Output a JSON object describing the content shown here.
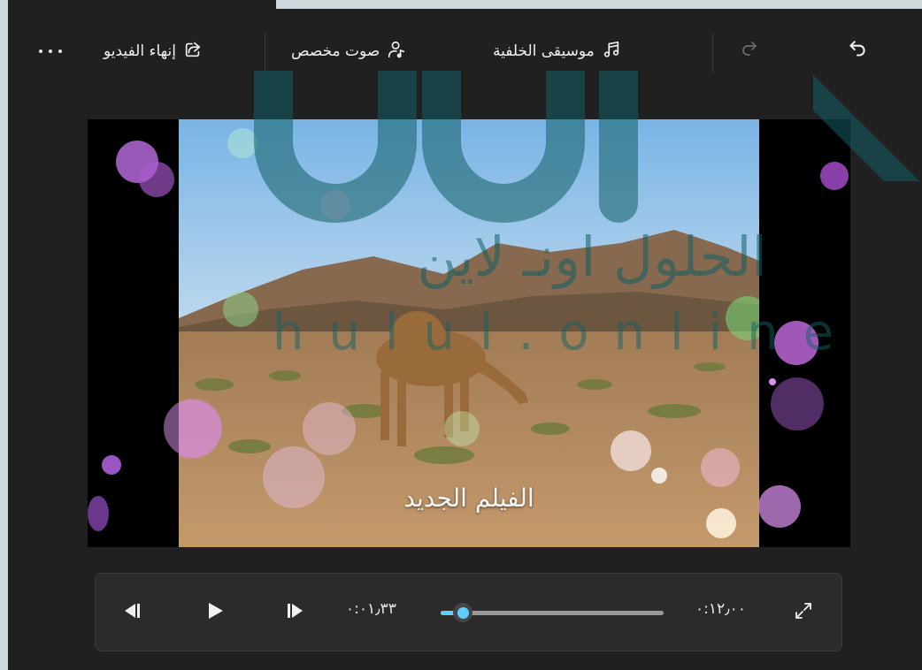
{
  "toolbar": {
    "undo_icon": "undo-icon",
    "redo_icon": "redo-icon",
    "background_music_label": "موسيقى الخلفية",
    "custom_audio_label": "صوت مخصص",
    "finish_video_label": "إنهاء الفيديو",
    "more_icon": "more-dots-icon"
  },
  "preview": {
    "caption": "الفيلم الجديد"
  },
  "watermark": {
    "arabic": "الحلول اونـ لاين",
    "latin": "hulul.online"
  },
  "player": {
    "current_time": "٠:٠١٫٣٣",
    "total_time": "٠:١٢٫٠٠",
    "progress": 0.1,
    "prev_frame_icon": "step-back-icon",
    "play_icon": "play-icon",
    "next_frame_icon": "step-forward-icon",
    "fullscreen_icon": "expand-icon"
  },
  "colors": {
    "accent": "#60cdff",
    "background": "#202020",
    "controls_bg": "#2b2b2b"
  }
}
